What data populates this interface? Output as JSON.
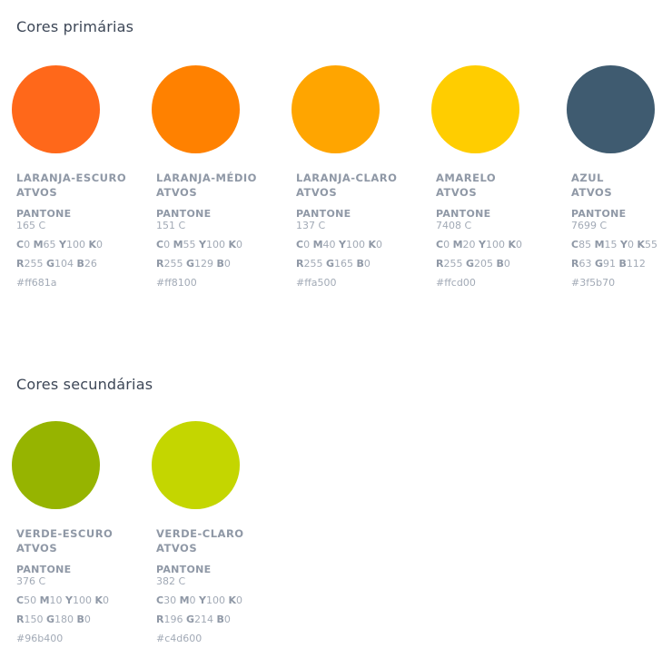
{
  "primary": {
    "title": "Cores primárias",
    "colors": [
      {
        "name1": "LARANJA-ESCURO",
        "name2": "ATVOS",
        "pantone_label": "PANTONE",
        "pantone": "165 C",
        "c": "0",
        "m": "65",
        "y": "100",
        "k": "0",
        "r": "255",
        "g": "104",
        "b": "26",
        "hex": "#ff681a"
      },
      {
        "name1": "LARANJA-MÉDIO",
        "name2": "ATVOS",
        "pantone_label": "PANTONE",
        "pantone": "151 C",
        "c": "0",
        "m": "55",
        "y": "100",
        "k": "0",
        "r": "255",
        "g": "129",
        "b": "0",
        "hex": "#ff8100"
      },
      {
        "name1": "LARANJA-CLARO",
        "name2": "ATVOS",
        "pantone_label": "PANTONE",
        "pantone": "137 C",
        "c": "0",
        "m": "40",
        "y": "100",
        "k": "0",
        "r": "255",
        "g": "165",
        "b": "0",
        "hex": "#ffa500"
      },
      {
        "name1": "AMARELO",
        "name2": "ATVOS",
        "pantone_label": "PANTONE",
        "pantone": "7408 C",
        "c": "0",
        "m": "20",
        "y": "100",
        "k": "0",
        "r": "255",
        "g": "205",
        "b": "0",
        "hex": "#ffcd00"
      },
      {
        "name1": "AZUL",
        "name2": "ATVOS",
        "pantone_label": "PANTONE",
        "pantone": "7699 C",
        "c": "85",
        "m": "15",
        "y": "0",
        "k": "55",
        "r": "63",
        "g": "91",
        "b": "112",
        "hex": "#3f5b70"
      }
    ]
  },
  "secondary": {
    "title": "Cores secundárias",
    "colors": [
      {
        "name1": "VERDE-ESCURO",
        "name2": "ATVOS",
        "pantone_label": "PANTONE",
        "pantone": "376 C",
        "c": "50",
        "m": "10",
        "y": "100",
        "k": "0",
        "r": "150",
        "g": "180",
        "b": "0",
        "hex": "#96b400"
      },
      {
        "name1": "VERDE-CLARO",
        "name2": "ATVOS",
        "pantone_label": "PANTONE",
        "pantone": "382 C",
        "c": "30",
        "m": "0",
        "y": "100",
        "k": "0",
        "r": "196",
        "g": "214",
        "b": "0",
        "hex": "#c4d600"
      }
    ]
  }
}
